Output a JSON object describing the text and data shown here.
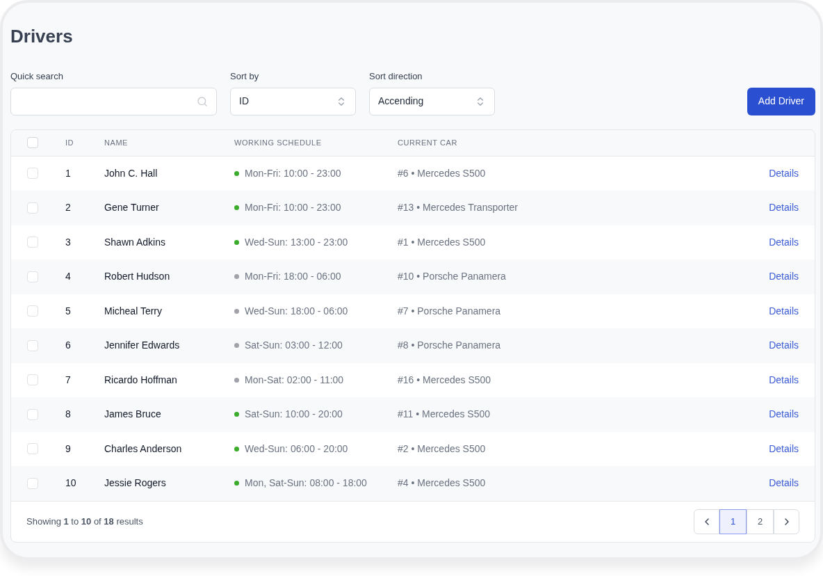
{
  "page": {
    "title": "Drivers"
  },
  "filters": {
    "search": {
      "label": "Quick search"
    },
    "sort_by": {
      "label": "Sort by",
      "value": "ID"
    },
    "sort_direction": {
      "label": "Sort direction",
      "value": "Accending"
    },
    "add_button": "Add Driver"
  },
  "table": {
    "select_all": {
      "checked": false
    },
    "columns": [
      "ID",
      "NAME",
      "WORKING SCHEDULE",
      "CURRENT CAR"
    ],
    "rows": [
      {
        "checked": false,
        "id": "1",
        "name": "John C. Hall",
        "schedule": "Mon-Fri: 10:00 - 23:00",
        "color": "#3bab2b",
        "car": "#6 • Mercedes S500",
        "action": "Details"
      },
      {
        "checked": false,
        "id": "2",
        "name": "Gene Turner",
        "schedule": "Mon-Fri: 10:00 - 23:00",
        "color": "#3bab2b",
        "car": "#13 • Mercedes Transporter",
        "action": "Details"
      },
      {
        "checked": false,
        "id": "3",
        "name": "Shawn Adkins",
        "schedule": "Wed-Sun: 13:00 - 23:00",
        "color": "#3bab2b",
        "car": "#1 • Mercedes S500",
        "action": "Details"
      },
      {
        "checked": false,
        "id": "4",
        "name": "Robert Hudson",
        "schedule": "Mon-Fri: 18:00 - 06:00",
        "color": "#a1a1aa",
        "car": "#10 • Porsche Panamera",
        "action": "Details"
      },
      {
        "checked": false,
        "id": "5",
        "name": "Micheal Terry",
        "schedule": "Wed-Sun: 18:00 - 06:00",
        "color": "#a1a1aa",
        "car": "#7 • Porsche Panamera",
        "action": "Details"
      },
      {
        "checked": false,
        "id": "6",
        "name": "Jennifer Edwards",
        "schedule": "Sat-Sun: 03:00 - 12:00",
        "color": "#a1a1aa",
        "car": "#8 • Porsche Panamera",
        "action": "Details"
      },
      {
        "checked": false,
        "id": "7",
        "name": "Ricardo Hoffman",
        "schedule": "Mon-Sat: 02:00 - 11:00",
        "color": "#a1a1aa",
        "car": "#16 • Mercedes S500",
        "action": "Details"
      },
      {
        "checked": false,
        "id": "8",
        "name": "James Bruce",
        "schedule": "Sat-Sun: 10:00 - 20:00",
        "color": "#3bab2b",
        "car": "#11 • Mercedes S500",
        "action": "Details"
      },
      {
        "checked": false,
        "id": "9",
        "name": "Charles Anderson",
        "schedule": "Wed-Sun: 06:00 - 20:00",
        "color": "#3bab2b",
        "car": "#2 • Mercedes S500",
        "action": "Details"
      },
      {
        "checked": false,
        "id": "10",
        "name": "Jessie Rogers",
        "schedule": "Mon, Sat-Sun: 08:00 - 18:00",
        "color": "#3bab2b",
        "car": "#4 • Mercedes S500",
        "action": "Details"
      }
    ]
  },
  "footer": {
    "summary": "Showing **1** to **10** of **18** results",
    "pages": [
      {
        "label": "1",
        "selected": true
      },
      {
        "label": "2",
        "selected": false
      }
    ]
  }
}
